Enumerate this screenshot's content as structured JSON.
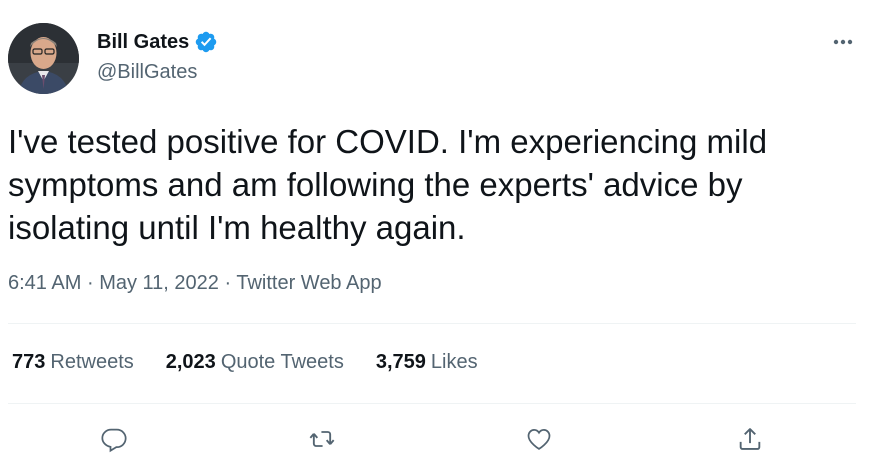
{
  "author": {
    "display_name": "Bill Gates",
    "handle": "@BillGates",
    "verified": true
  },
  "tweet": {
    "text": "I've tested positive for COVID. I'm experiencing mild symptoms and am following the experts' advice by isolating until I'm healthy again.",
    "time": "6:41 AM",
    "date": "May 11, 2022",
    "separator": "·",
    "source": "Twitter Web App"
  },
  "stats": [
    {
      "count": "773",
      "label": "Retweets"
    },
    {
      "count": "2,023",
      "label": "Quote Tweets"
    },
    {
      "count": "3,759",
      "label": "Likes"
    }
  ],
  "actions": [
    "reply-icon",
    "retweet-icon",
    "like-icon",
    "share-icon"
  ],
  "colors": {
    "text": "#0f1419",
    "secondary": "#536471",
    "verified": "#1d9bf0",
    "divider": "#eff3f4",
    "action_icon": "#536471"
  }
}
